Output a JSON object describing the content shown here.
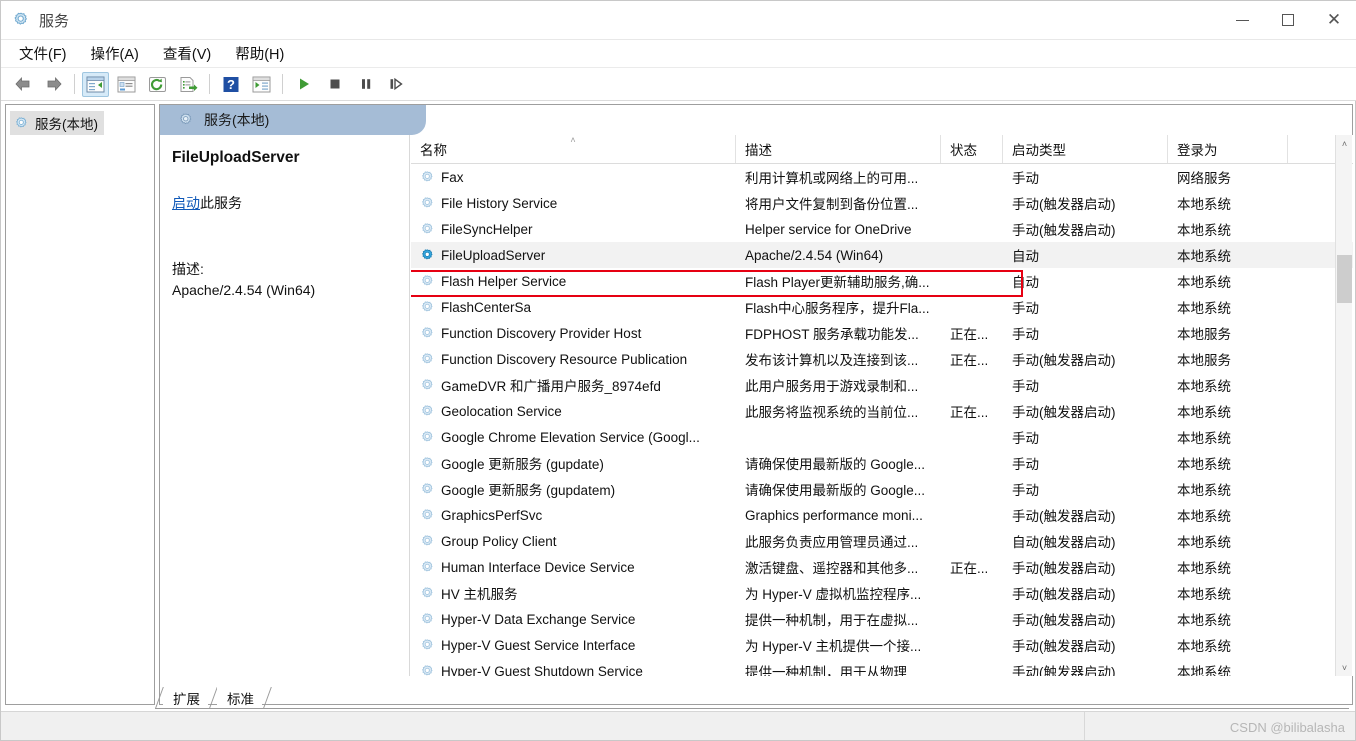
{
  "window": {
    "title": "服务",
    "title_icon": "services-gear-icon",
    "minimize_label": "最小化",
    "maximize_label": "最大化",
    "close_label": "关闭"
  },
  "menubar": {
    "items": [
      {
        "label": "文件(F)",
        "name": "menu-file"
      },
      {
        "label": "操作(A)",
        "name": "menu-action"
      },
      {
        "label": "查看(V)",
        "name": "menu-view"
      },
      {
        "label": "帮助(H)",
        "name": "menu-help"
      }
    ]
  },
  "toolbar": {
    "buttons": [
      {
        "icon": "back-arrow-icon",
        "label": "后退"
      },
      {
        "icon": "forward-arrow-icon",
        "label": "前进"
      },
      {
        "icon": "show-hide-console-tree-icon",
        "label": "显示/隐藏控制台树"
      },
      {
        "icon": "properties-icon",
        "label": "属性"
      },
      {
        "icon": "refresh-icon",
        "label": "刷新"
      },
      {
        "icon": "export-list-icon",
        "label": "导出列表"
      },
      {
        "icon": "help-icon",
        "label": "帮助"
      },
      {
        "icon": "show-action-pane-icon",
        "label": "显示/隐藏操作窗格"
      },
      {
        "icon": "start-service-icon",
        "label": "启动服务"
      },
      {
        "icon": "stop-service-icon",
        "label": "停止服务"
      },
      {
        "icon": "pause-service-icon",
        "label": "暂停服务"
      },
      {
        "icon": "restart-service-icon",
        "label": "重新启动服务"
      }
    ]
  },
  "tree": {
    "items": [
      {
        "label": "服务(本地)",
        "icon": "services-gear-icon",
        "selected": true
      }
    ]
  },
  "pane": {
    "header": "服务(本地)",
    "header_icon": "services-gear-icon"
  },
  "details": {
    "service_name": "FileUploadServer",
    "action_link": "启动",
    "action_suffix": "此服务",
    "description_label": "描述:",
    "description_value": "Apache/2.4.54 (Win64)"
  },
  "table": {
    "columns": [
      {
        "label": "名称",
        "key": "name",
        "sorted": "asc"
      },
      {
        "label": "描述",
        "key": "desc"
      },
      {
        "label": "状态",
        "key": "state"
      },
      {
        "label": "启动类型",
        "key": "start"
      },
      {
        "label": "登录为",
        "key": "login"
      }
    ],
    "sort_caret": "˄",
    "rows": [
      {
        "name": "Fax",
        "desc": "利用计算机或网络上的可用...",
        "state": "",
        "start": "手动",
        "login": "网络服务",
        "selected": false
      },
      {
        "name": "File History Service",
        "desc": "将用户文件复制到备份位置...",
        "state": "",
        "start": "手动(触发器启动)",
        "login": "本地系统",
        "selected": false
      },
      {
        "name": "FileSyncHelper",
        "desc": "Helper service for OneDrive",
        "state": "",
        "start": "手动(触发器启动)",
        "login": "本地系统",
        "selected": false
      },
      {
        "name": "FileUploadServer",
        "desc": "Apache/2.4.54 (Win64)",
        "state": "",
        "start": "自动",
        "login": "本地系统",
        "selected": true
      },
      {
        "name": "Flash Helper Service",
        "desc": "Flash Player更新辅助服务,确...",
        "state": "",
        "start": "自动",
        "login": "本地系统",
        "selected": false
      },
      {
        "name": "FlashCenterSa",
        "desc": "Flash中心服务程序，提升Fla...",
        "state": "",
        "start": "手动",
        "login": "本地系统",
        "selected": false
      },
      {
        "name": "Function Discovery Provider Host",
        "desc": "FDPHOST 服务承载功能发...",
        "state": "正在...",
        "start": "手动",
        "login": "本地服务",
        "selected": false
      },
      {
        "name": "Function Discovery Resource Publication",
        "desc": "发布该计算机以及连接到该...",
        "state": "正在...",
        "start": "手动(触发器启动)",
        "login": "本地服务",
        "selected": false
      },
      {
        "name": "GameDVR 和广播用户服务_8974efd",
        "desc": "此用户服务用于游戏录制和...",
        "state": "",
        "start": "手动",
        "login": "本地系统",
        "selected": false
      },
      {
        "name": "Geolocation Service",
        "desc": "此服务将监视系统的当前位...",
        "state": "正在...",
        "start": "手动(触发器启动)",
        "login": "本地系统",
        "selected": false
      },
      {
        "name": "Google Chrome Elevation Service (Googl...",
        "desc": "",
        "state": "",
        "start": "手动",
        "login": "本地系统",
        "selected": false
      },
      {
        "name": "Google 更新服务 (gupdate)",
        "desc": "请确保使用最新版的 Google...",
        "state": "",
        "start": "手动",
        "login": "本地系统",
        "selected": false
      },
      {
        "name": "Google 更新服务 (gupdatem)",
        "desc": "请确保使用最新版的 Google...",
        "state": "",
        "start": "手动",
        "login": "本地系统",
        "selected": false
      },
      {
        "name": "GraphicsPerfSvc",
        "desc": "Graphics performance moni...",
        "state": "",
        "start": "手动(触发器启动)",
        "login": "本地系统",
        "selected": false
      },
      {
        "name": "Group Policy Client",
        "desc": "此服务负责应用管理员通过...",
        "state": "",
        "start": "自动(触发器启动)",
        "login": "本地系统",
        "selected": false
      },
      {
        "name": "Human Interface Device Service",
        "desc": "激活键盘、遥控器和其他多...",
        "state": "正在...",
        "start": "手动(触发器启动)",
        "login": "本地系统",
        "selected": false
      },
      {
        "name": "HV 主机服务",
        "desc": "为 Hyper-V 虚拟机监控程序...",
        "state": "",
        "start": "手动(触发器启动)",
        "login": "本地系统",
        "selected": false
      },
      {
        "name": "Hyper-V Data Exchange Service",
        "desc": "提供一种机制，用于在虚拟...",
        "state": "",
        "start": "手动(触发器启动)",
        "login": "本地系统",
        "selected": false
      },
      {
        "name": "Hyper-V Guest Service Interface",
        "desc": "为 Hyper-V 主机提供一个接...",
        "state": "",
        "start": "手动(触发器启动)",
        "login": "本地系统",
        "selected": false
      },
      {
        "name": "Hyper-V Guest Shutdown Service",
        "desc": "提供一种机制，用于从物理",
        "state": "",
        "start": "手动(触发器启动)",
        "login": "本地系统",
        "selected": false
      }
    ]
  },
  "scrollbar": {
    "up_arrow": "˄",
    "down_arrow": "˅"
  },
  "bottom_tabs": [
    {
      "label": "扩展",
      "name": "tab-extended",
      "active": false
    },
    {
      "label": "标准",
      "name": "tab-standard",
      "active": true
    }
  ],
  "statusbar": {
    "watermark_brand": "CSDN",
    "watermark_user": "@bilibalasha"
  },
  "colors": {
    "accent": "#a5bcd6",
    "link": "#1059b8",
    "highlight_box": "#e60012",
    "selected_row": "#f2f2f2"
  }
}
